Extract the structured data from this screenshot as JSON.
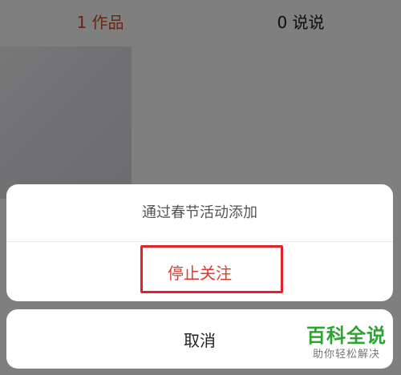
{
  "tabs": {
    "works": "1 作品",
    "posts": "0 说说"
  },
  "action_sheet": {
    "subtitle": "通过春节活动添加",
    "unfollow_label": "停止关注",
    "cancel_label": "取消"
  },
  "watermark": {
    "title": "百科全说",
    "subtitle": "助你轻松解决"
  },
  "colors": {
    "accent": "#c8512b",
    "danger": "#e03a2e",
    "highlight": "#e8202a",
    "watermark": "#2aa52e"
  }
}
